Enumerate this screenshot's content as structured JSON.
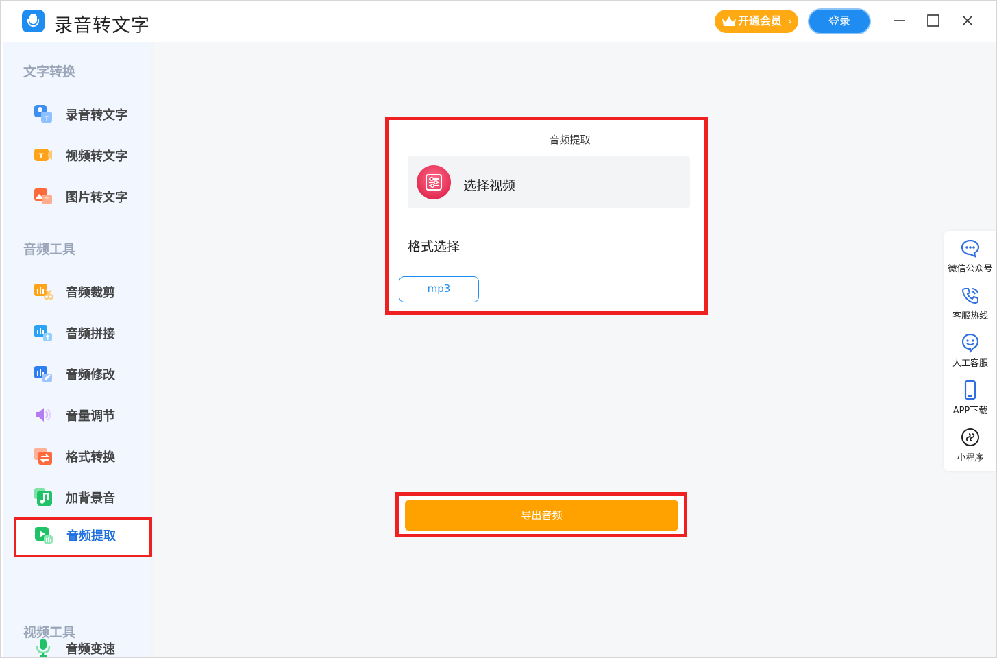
{
  "app": {
    "title": "录音转文字",
    "vip_label": "开通会员",
    "vip_chevron": "›",
    "login_label": "登录"
  },
  "window_controls": {
    "minimize": "minimize-icon",
    "maximize": "maximize-icon",
    "close": "close-icon"
  },
  "sidebar": {
    "sections": [
      {
        "title": "文字转换",
        "items": [
          {
            "label": "录音转文字",
            "icon": "record-to-text-icon"
          },
          {
            "label": "视频转文字",
            "icon": "video-to-text-icon"
          },
          {
            "label": "图片转文字",
            "icon": "image-to-text-icon"
          }
        ]
      },
      {
        "title": "音频工具",
        "items": [
          {
            "label": "音频裁剪",
            "icon": "audio-cut-icon"
          },
          {
            "label": "音频拼接",
            "icon": "audio-merge-icon"
          },
          {
            "label": "音频修改",
            "icon": "audio-edit-icon"
          },
          {
            "label": "音量调节",
            "icon": "volume-icon"
          },
          {
            "label": "格式转换",
            "icon": "format-convert-icon"
          },
          {
            "label": "加背景音",
            "icon": "music-note-icon"
          },
          {
            "label": "音频提取",
            "icon": "audio-extract-icon",
            "active": true
          },
          {
            "label": "音频变速",
            "icon": "speed-mic-icon"
          }
        ]
      },
      {
        "title": "视频工具",
        "items": []
      }
    ]
  },
  "panel": {
    "title": "音频提取",
    "select_video_label": "选择视频",
    "format_label": "格式选择",
    "format_selected": "mp3",
    "export_label": "导出音频"
  },
  "floatbar": {
    "items": [
      {
        "label": "微信公众号",
        "icon": "wechat-chat-icon"
      },
      {
        "label": "客服热线",
        "icon": "phone-icon"
      },
      {
        "label": "人工客服",
        "icon": "support-face-icon"
      },
      {
        "label": "APP下载",
        "icon": "mobile-phone-icon"
      },
      {
        "label": "小程序",
        "icon": "mini-program-icon"
      }
    ]
  },
  "colors": {
    "accent_blue": "#1e8cf0",
    "vip_orange": "#ffa913",
    "export_orange": "#ffa200",
    "highlight_red": "#ef2020",
    "sidebar_bg": "#f1f6ff"
  }
}
